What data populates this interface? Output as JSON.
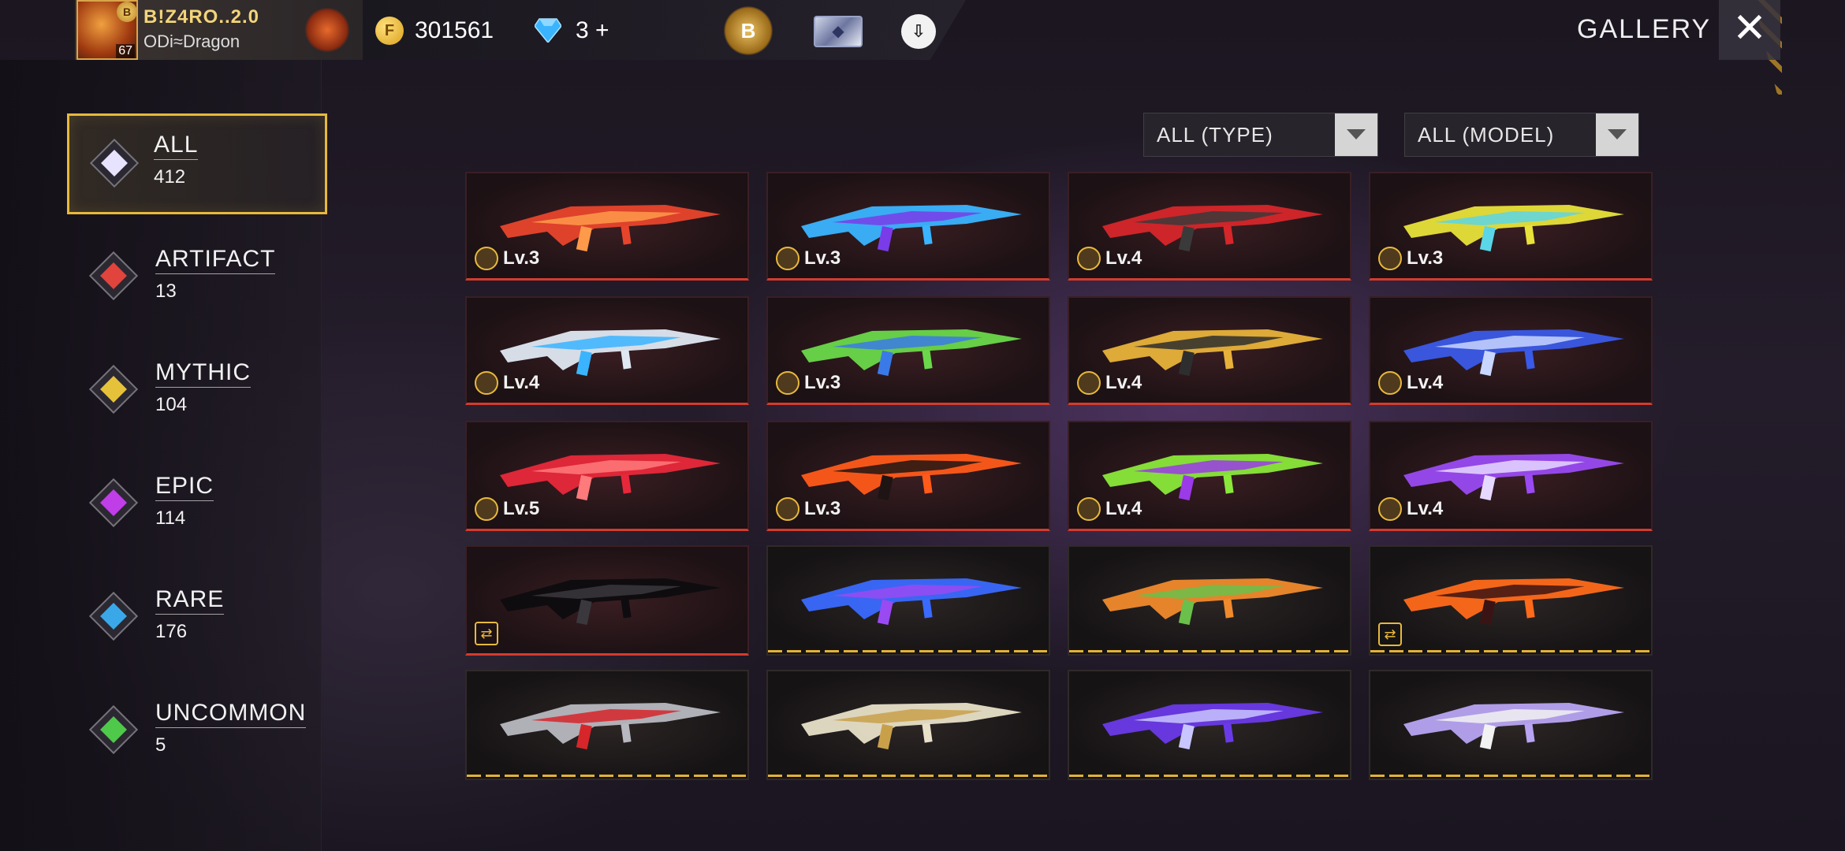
{
  "header": {
    "player_name": "B!Z4RO..2.0",
    "guild_name": "ODi≈Dragon",
    "level": "67",
    "rank_star": "B",
    "coins": "301561",
    "diamonds": "3",
    "diamonds_plus": "+",
    "rank_badge_letter": "B",
    "title": "GALLERY"
  },
  "sidebar": {
    "categories": [
      {
        "name": "ALL",
        "count": "412",
        "color": "#e7e3ff"
      },
      {
        "name": "ARTIFACT",
        "count": "13",
        "color": "#e0443c"
      },
      {
        "name": "MYTHIC",
        "count": "104",
        "color": "#e6c23a"
      },
      {
        "name": "EPIC",
        "count": "114",
        "color": "#c03ee8"
      },
      {
        "name": "RARE",
        "count": "176",
        "color": "#3aa8e8"
      },
      {
        "name": "UNCOMMON",
        "count": "5",
        "color": "#4ec94a"
      }
    ]
  },
  "filters": {
    "type": "ALL (TYPE)",
    "model": "ALL (MODEL)"
  },
  "grid": {
    "rows": [
      [
        {
          "level": "Lv.3",
          "rarity": "red",
          "icon": "flame-crest-icon",
          "art": "red-flame-rifle"
        },
        {
          "level": "Lv.3",
          "rarity": "red",
          "icon": "flame-crest-icon",
          "art": "blue-purple-dragon-rifle"
        },
        {
          "level": "Lv.4",
          "rarity": "red",
          "icon": "wolf-crest-icon",
          "art": "red-black-shark-rifle"
        },
        {
          "level": "Lv.3",
          "rarity": "red",
          "icon": "skull-crest-icon",
          "art": "neon-yellow-smg"
        }
      ],
      [
        {
          "level": "Lv.4",
          "rarity": "red",
          "icon": "bolt-crest-icon",
          "art": "white-blue-sniper"
        },
        {
          "level": "Lv.3",
          "rarity": "red",
          "icon": "flame-crest-icon",
          "art": "green-energy-rifle"
        },
        {
          "level": "Lv.4",
          "rarity": "red",
          "icon": "mask-crest-icon",
          "art": "gold-black-shotgun"
        },
        {
          "level": "Lv.4",
          "rarity": "red",
          "icon": "skull-crest-icon",
          "art": "blue-lightning-smg"
        }
      ],
      [
        {
          "level": "Lv.5",
          "rarity": "red",
          "icon": "shield-crest-icon",
          "art": "red-crystal-smg"
        },
        {
          "level": "Lv.3",
          "rarity": "red",
          "icon": "crown-crest-icon",
          "art": "lava-rifle"
        },
        {
          "level": "Lv.4",
          "rarity": "red",
          "icon": "flame-crest-icon",
          "art": "green-purple-rifle"
        },
        {
          "level": "Lv.4",
          "rarity": "red",
          "icon": "plus-crest-icon",
          "art": "purple-void-rifle"
        }
      ],
      [
        {
          "level": "",
          "rarity": "red",
          "icon": "swap-icon",
          "art": "black-blade"
        },
        {
          "level": "",
          "rarity": "gold",
          "icon": "",
          "art": "blue-wing-rifle"
        },
        {
          "level": "",
          "rarity": "gold",
          "icon": "",
          "art": "carrot-rocket-launcher"
        },
        {
          "level": "",
          "rarity": "gold",
          "icon": "swap-icon",
          "art": "fire-ring-launcher"
        }
      ],
      [
        {
          "level": "",
          "rarity": "gold",
          "icon": "",
          "art": "silver-red-beast-rifle"
        },
        {
          "level": "",
          "rarity": "gold",
          "icon": "",
          "art": "golden-silver-rifle"
        },
        {
          "level": "",
          "rarity": "gold",
          "icon": "",
          "art": "purple-scythe"
        },
        {
          "level": "",
          "rarity": "gold",
          "icon": "",
          "art": "crystal-fist"
        }
      ]
    ]
  },
  "colors": {
    "accent_gold": "#e7b93c",
    "rarity_red": "#d43b2e"
  }
}
